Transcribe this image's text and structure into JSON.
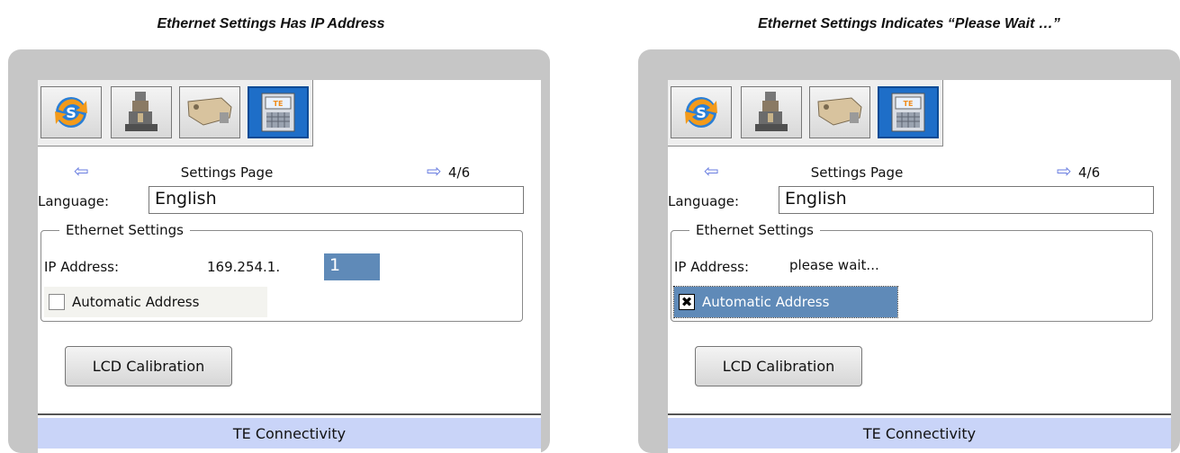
{
  "captions": {
    "left": "Ethernet Settings Has IP Address",
    "right": "Ethernet Settings Indicates “Please Wait …”"
  },
  "panels": [
    {
      "toolbar_icons": [
        "sync-icon",
        "machine-icon",
        "applicator-icon",
        "te-settings-icon"
      ],
      "title": "Settings Page",
      "page_indicator": "4/6",
      "language_label": "Language:",
      "language_value": "English",
      "ethernet_group": "Ethernet Settings",
      "ip_label": "IP Address:",
      "ip_prefix": "169.254.1.",
      "ip_last_octet": "1",
      "auto_address_label": "Automatic Address",
      "auto_address_checked": false,
      "lcd_button": "LCD Calibration",
      "footer": "TE Connectivity"
    },
    {
      "toolbar_icons": [
        "sync-icon",
        "machine-icon",
        "applicator-icon",
        "te-settings-icon"
      ],
      "title": "Settings Page",
      "page_indicator": "4/6",
      "language_label": "Language:",
      "language_value": "English",
      "ethernet_group": "Ethernet Settings",
      "ip_label": "IP Address:",
      "ip_status": "please wait...",
      "auto_address_label": "Automatic Address",
      "auto_address_checked": true,
      "auto_address_mark": "✖",
      "lcd_button": "LCD Calibration",
      "footer": "TE Connectivity"
    }
  ],
  "colors": {
    "frame": "#c6c6c6",
    "active_tab": "#1e6ec8",
    "selection": "#5f8ab8",
    "footer_bg": "#c9d4f8",
    "nav_arrow": "#6a7ee0"
  }
}
